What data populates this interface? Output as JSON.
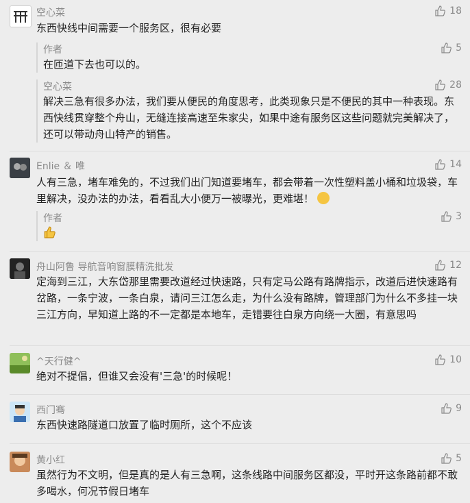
{
  "comments": [
    {
      "author": "空心菜",
      "likes": "18",
      "text": "东西快线中间需要一个服务区，很有必要",
      "replies": [
        {
          "author": "作者",
          "likes": "5",
          "text": "在匝道下去也可以的。"
        },
        {
          "author": "空心菜",
          "likes": "28",
          "text": "解决三急有很多办法，我们要从便民的角度思考，此类现象只是不便民的其中一种表现。东西快线贯穿整个舟山，无缝连接高速至朱家尖，如果中途有服务区这些问题就完美解决了，还可以带动舟山特产的销售。"
        }
      ]
    },
    {
      "author": "Enlie ＆ 唯",
      "likes": "14",
      "text": "人有三急，堵车难免的，不过我们出门知道要堵车，都会带着一次性塑料盖小桶和垃圾袋，车里解决，没办法的办法，看看乱大小便万一被曝光，更难堪！",
      "replies": [
        {
          "author": "作者",
          "likes": "3",
          "text": ""
        }
      ]
    },
    {
      "author": "舟山阿鲁 导航音响窗膜精洗批发",
      "likes": "12",
      "text": "定海到三江，大东岱那里需要改道经过快速路，只有定马公路有路牌指示，改道后进快速路有岔路，一条宁波，一条白泉，请问三江怎么走，为什么没有路牌，管理部门为什么不多挂一块三江方向，早知道上路的不一定都是本地车，走错要往白泉方向绕一大圈，有意思吗"
    },
    {
      "author": "^天行健^",
      "likes": "10",
      "text": "绝对不提倡，但谁又会没有'三急'的时候呢！"
    },
    {
      "author": "西门骞",
      "likes": "9",
      "text": "东西快速路隧道口放置了临时厕所，这个不应该"
    },
    {
      "author": "黄小红",
      "likes": "5",
      "text": "虽然行为不文明，但是真的是人有三急啊，这条线路中间服务区都没，平时开这条路前都不敢多喝水，何况节假日堵车"
    }
  ],
  "icons": {
    "like": "thumbs-up-icon",
    "emoji_grin": "grin-emoji-icon",
    "emoji_thumb": "thumbs-up-emoji-icon"
  }
}
